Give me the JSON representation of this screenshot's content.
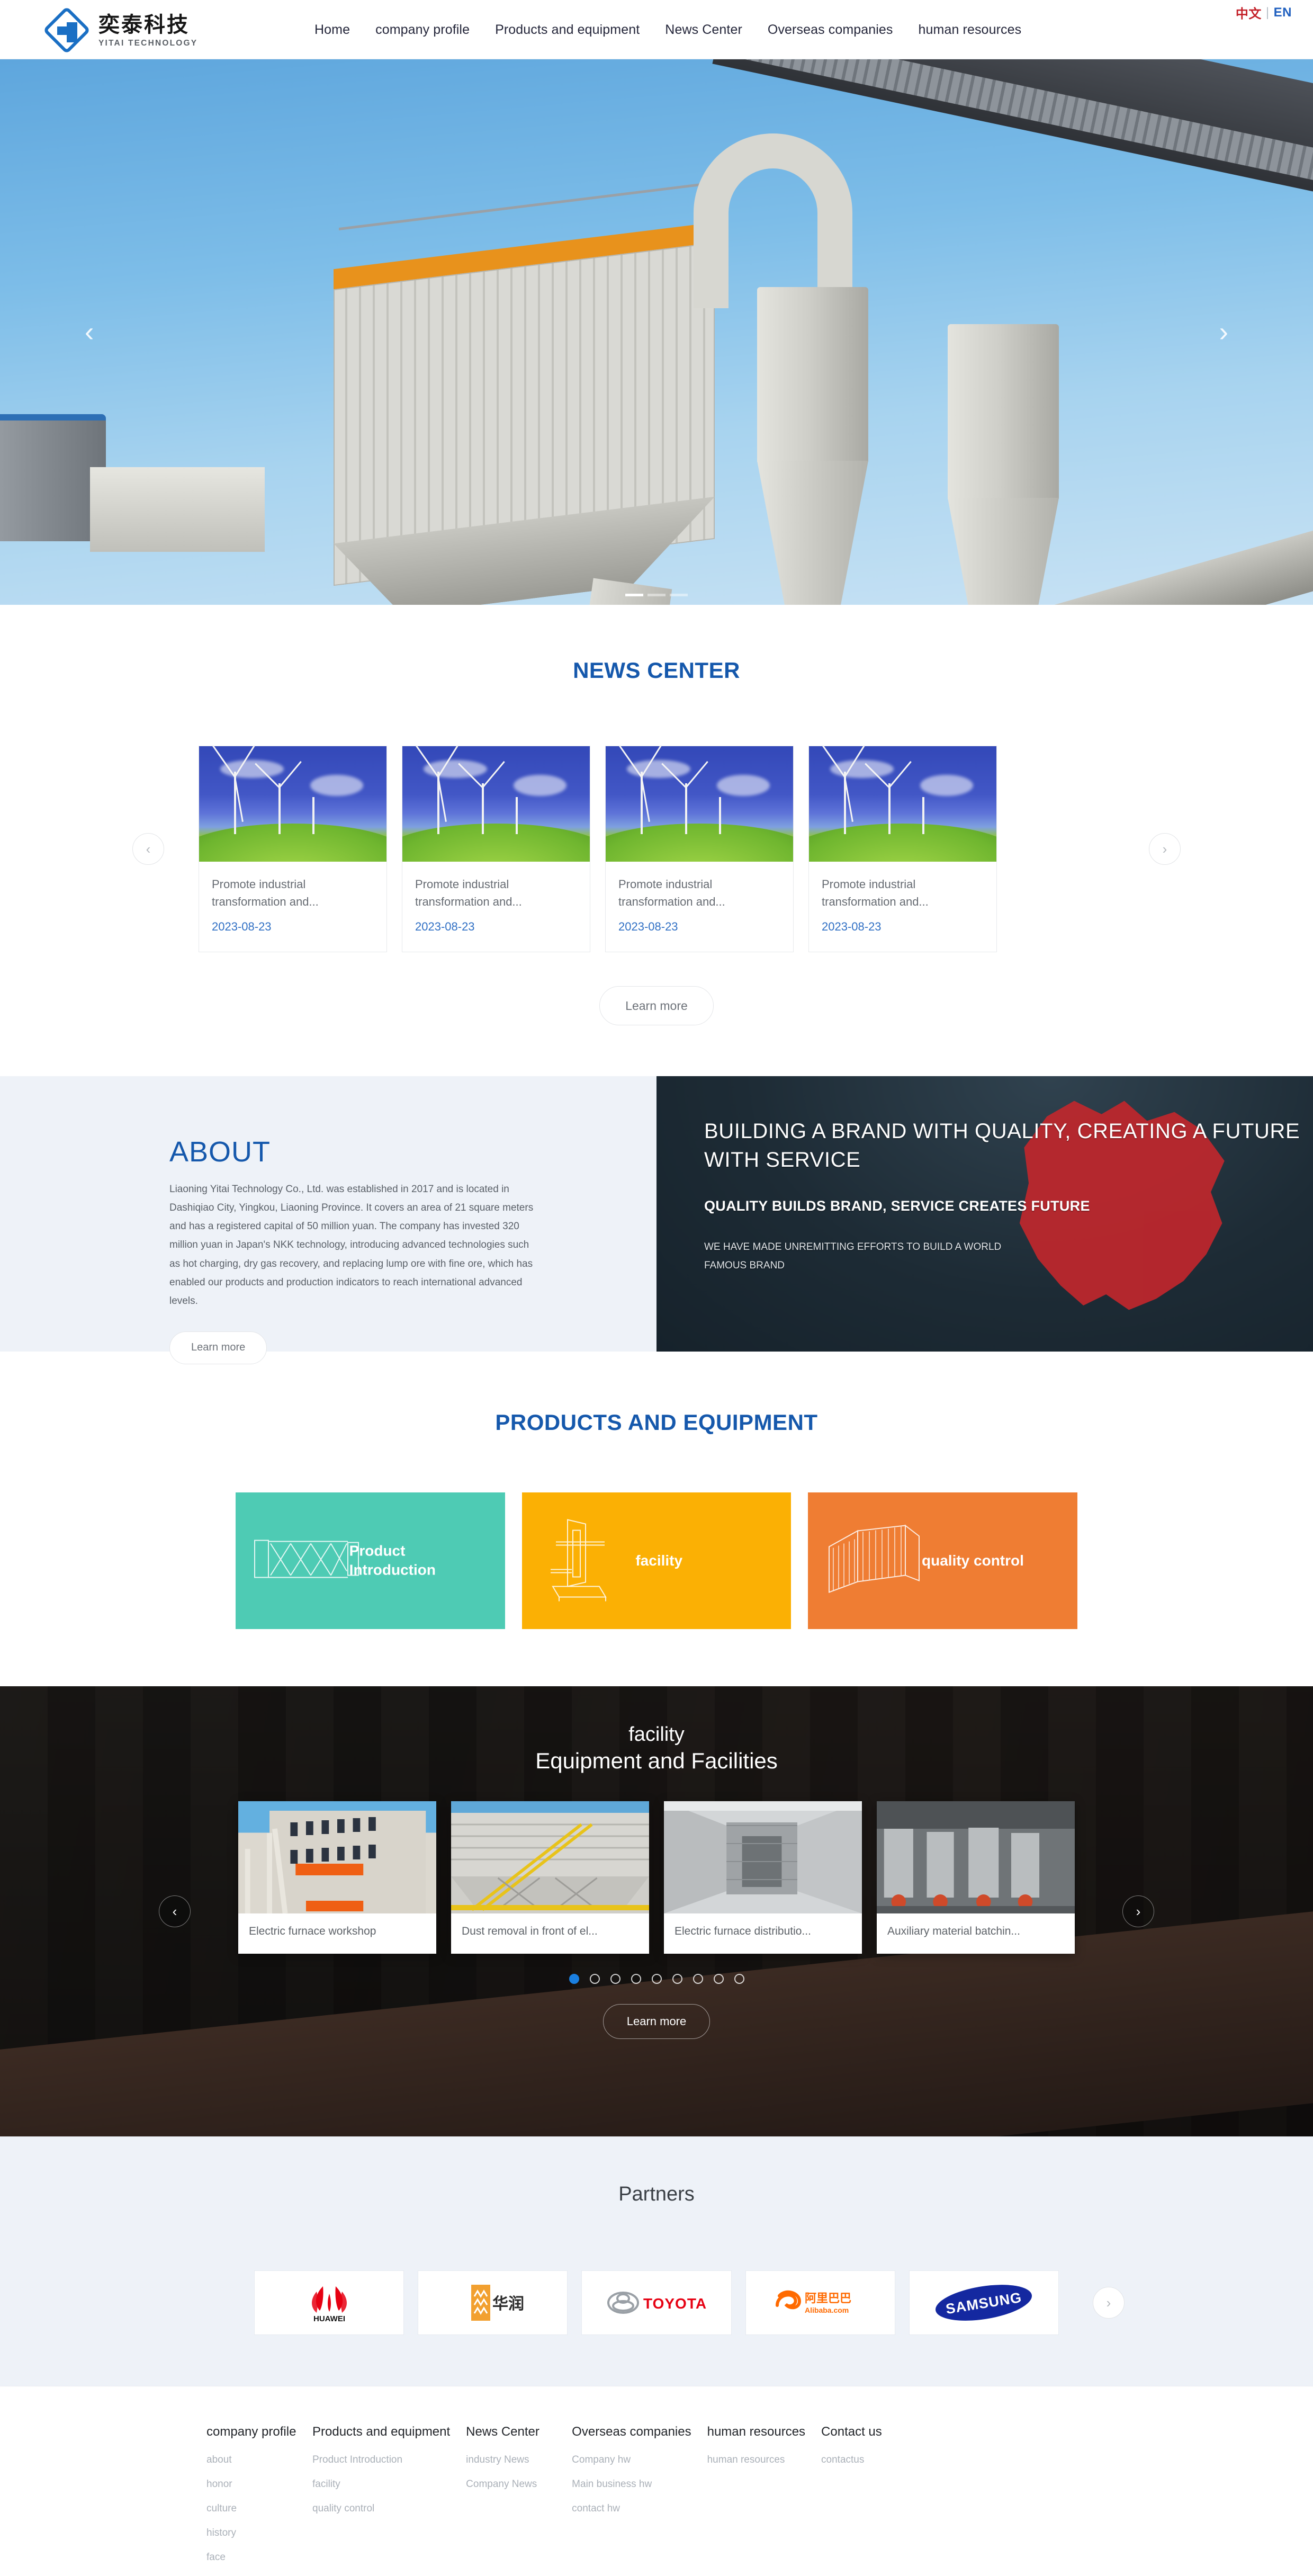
{
  "header": {
    "lang": {
      "cn": "中文",
      "sep": "|",
      "en": "EN"
    },
    "logo": {
      "zh": "奕泰科技",
      "en": "YITAI TECHNOLOGY"
    },
    "nav": [
      {
        "label": "Home"
      },
      {
        "label": "company profile"
      },
      {
        "label": "Products and equipment"
      },
      {
        "label": "News Center"
      },
      {
        "label": "Overseas companies"
      },
      {
        "label": "human resources"
      }
    ]
  },
  "hero": {
    "prev": "‹",
    "next": "›",
    "slide_count": 3,
    "active_slide": 1
  },
  "news": {
    "title": "NEWS CENTER",
    "prev": "‹",
    "next": "›",
    "learn_more": "Learn more",
    "cards": [
      {
        "title": "Promote industrial transformation and...",
        "date": "2023-08-23"
      },
      {
        "title": "Promote industrial transformation and...",
        "date": "2023-08-23"
      },
      {
        "title": "Promote industrial transformation and...",
        "date": "2023-08-23"
      },
      {
        "title": "Promote industrial transformation and...",
        "date": "2023-08-23"
      }
    ]
  },
  "about": {
    "title": "ABOUT",
    "body": "Liaoning Yitai Technology Co., Ltd. was established in 2017 and is located in Dashiqiao City, Yingkou, Liaoning Province. It covers an area of 21 square meters and has a registered capital of 50 million yuan. The company has invested 320 million yuan in Japan's NKK technology, introducing advanced technologies such as hot charging, dry gas recovery, and replacing lump ore with fine ore, which has enabled our products and production indicators to reach international advanced levels.",
    "learn_more": "Learn more",
    "banner": {
      "headline": "BUILDING A BRAND WITH QUALITY, CREATING A FUTURE WITH SERVICE",
      "subhead": "QUALITY BUILDS BRAND, SERVICE CREATES FUTURE",
      "caption": "WE HAVE MADE UNREMITTING EFFORTS TO BUILD A WORLD FAMOUS BRAND",
      "map_color": "#c0272d"
    }
  },
  "products": {
    "title": "PRODUCTS AND EQUIPMENT",
    "cards": [
      {
        "label": "Product Introduction",
        "color": "#4ecbb4",
        "icon": "expandable-gate-icon"
      },
      {
        "label": "facility",
        "color": "#fbb004",
        "icon": "machine-icon"
      },
      {
        "label": "quality control",
        "color": "#ef7d33",
        "icon": "fence-panel-icon"
      }
    ]
  },
  "facility": {
    "small_title": "facility",
    "big_title": "Equipment and Facilities",
    "learn_more": "Learn more",
    "prev": "‹",
    "next": "›",
    "dots_total": 9,
    "dots_active": 1,
    "cards": [
      {
        "caption": "Electric furnace workshop"
      },
      {
        "caption": "Dust removal in front of el..."
      },
      {
        "caption": "Electric furnace distributio..."
      },
      {
        "caption": "Auxiliary material batchin..."
      }
    ]
  },
  "partners": {
    "title": "Partners",
    "next": "›",
    "logos": [
      {
        "name": "HUAWEI",
        "color": "#e60012"
      },
      {
        "name": "华润",
        "color": "#f2a030"
      },
      {
        "name": "TOYOTA",
        "color": "#e60012"
      },
      {
        "name": "阿里巴巴 Alibaba.com",
        "color": "#ff6a00"
      },
      {
        "name": "SAMSUNG",
        "color": "#1428a0"
      }
    ]
  },
  "footer": {
    "columns": [
      {
        "heading": "company profile",
        "links": [
          "about",
          "honor",
          "culture",
          "history",
          "face"
        ]
      },
      {
        "heading": "Products and equipment",
        "links": [
          "Product Introduction",
          "facility",
          "quality control"
        ]
      },
      {
        "heading": "News Center",
        "links": [
          "industry News",
          "Company News"
        ]
      },
      {
        "heading": "Overseas companies",
        "links": [
          "Company hw",
          "Main business hw",
          "contact hw"
        ]
      },
      {
        "heading": "human resources",
        "links": [
          "human resources"
        ]
      },
      {
        "heading": "Contact us",
        "links": [
          "contactus"
        ]
      }
    ]
  }
}
